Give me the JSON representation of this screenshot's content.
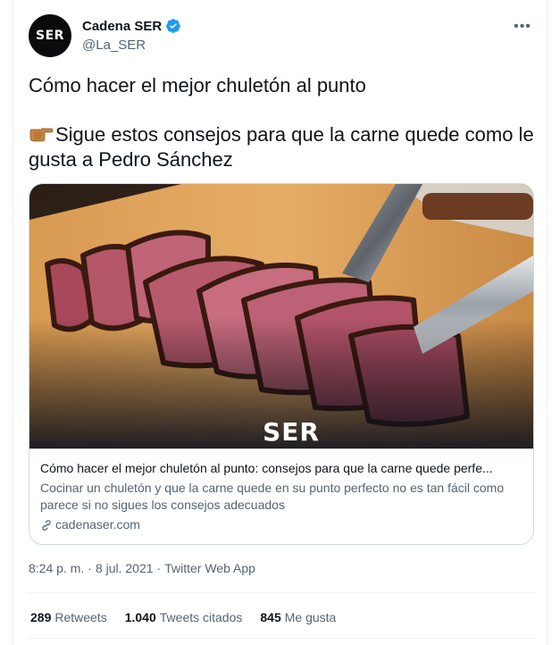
{
  "tweet": {
    "author": {
      "display_name": "Cadena SER",
      "handle": "@La_SER",
      "avatar_logo": "SER",
      "verified_icon": "verified-badge-icon",
      "verified_color": "#1d9bf0"
    },
    "more_label": "•••",
    "text_line1": "Cómo hacer el mejor chuletón al punto",
    "text_line2": "Sigue estos consejos para que la carne quede como le gusta a Pedro Sánchez",
    "emoji_icon": "backhand-index-pointing-right-icon",
    "card": {
      "image_logo": "SER",
      "image_icon": "sliced-steak-photo",
      "title": "Cómo hacer el mejor chuletón al punto: consejos para que la carne quede perfe...",
      "description": "Cocinar un chuletón y que la carne quede en su punto perfecto no es tan fácil como parece si no sigues los consejos adecuados",
      "domain": "cadenaser.com",
      "domain_icon": "link-icon"
    },
    "meta": {
      "time": "8:24 p. m.",
      "date": "8 jul. 2021",
      "source": "Twitter Web App"
    },
    "stats": {
      "retweets_count": "289",
      "retweets_label": "Retweets",
      "quotes_count": "1.040",
      "quotes_label": "Tweets citados",
      "likes_count": "845",
      "likes_label": "Me gusta"
    }
  }
}
